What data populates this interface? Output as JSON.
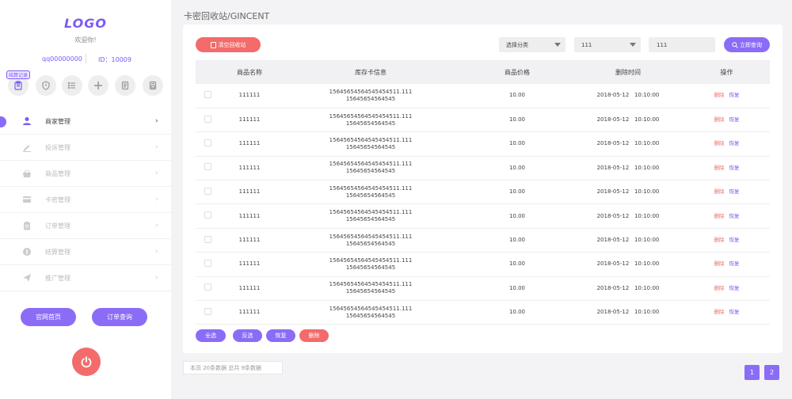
{
  "sidebar": {
    "logo": "LOGO",
    "welcome": "欢迎你!",
    "account": "qq00000000",
    "user_id": "ID：10009",
    "icon_tag": "结算记录",
    "icons": [
      "clipboard-icon",
      "shield-icon",
      "list-icon",
      "plus-icon",
      "document-icon",
      "invoice-icon"
    ],
    "menu": [
      {
        "label": "商家管理",
        "icon": "user-icon",
        "active": true
      },
      {
        "label": "投诉管理",
        "icon": "pencil-icon",
        "active": false
      },
      {
        "label": "商品管理",
        "icon": "basket-icon",
        "active": false
      },
      {
        "label": "卡密管理",
        "icon": "card-icon",
        "active": false
      },
      {
        "label": "订单管理",
        "icon": "clipboard-icon",
        "active": false
      },
      {
        "label": "结算管理",
        "icon": "coin-icon",
        "active": false
      },
      {
        "label": "推广管理",
        "icon": "send-icon",
        "active": false
      }
    ],
    "home_button": "官网首页",
    "order_button": "订单查询"
  },
  "header": {
    "title": "卡密回收站/GINCENT"
  },
  "toolbar": {
    "clear_button": "清空回收站",
    "category_select": "选择分类",
    "second_select": "111",
    "search_value": "111",
    "query_button": "立即查询"
  },
  "table": {
    "columns": [
      "商品名称",
      "库存卡信息",
      "商品价格",
      "删除时间",
      "操作"
    ],
    "rows": [
      {
        "name": "111111",
        "card_line1": "15645654564545454511.111",
        "card_line2": "15645654564545",
        "price": "10.00",
        "time": "2018-05-12   10:10:00"
      },
      {
        "name": "111111",
        "card_line1": "15645654564545454511.111",
        "card_line2": "15645654564545",
        "price": "10.00",
        "time": "2018-05-12   10:10:00"
      },
      {
        "name": "111111",
        "card_line1": "15645654564545454511.111",
        "card_line2": "15645654564545",
        "price": "10.00",
        "time": "2018-05-12   10:10:00"
      },
      {
        "name": "111111",
        "card_line1": "15645654564545454511.111",
        "card_line2": "15645654564545",
        "price": "10.00",
        "time": "2018-05-12   10:10:00"
      },
      {
        "name": "111111",
        "card_line1": "15645654564545454511.111",
        "card_line2": "15645654564545",
        "price": "10.00",
        "time": "2018-05-12   10:10:00"
      },
      {
        "name": "111111",
        "card_line1": "15645654564545454511.111",
        "card_line2": "15645654564545",
        "price": "10.00",
        "time": "2018-05-12   10:10:00"
      },
      {
        "name": "111111",
        "card_line1": "15645654564545454511.111",
        "card_line2": "15645654564545",
        "price": "10.00",
        "time": "2018-05-12   10:10:00"
      },
      {
        "name": "111111",
        "card_line1": "15645654564545454511.111",
        "card_line2": "15645654564545",
        "price": "10.00",
        "time": "2018-05-12   10:10:00"
      },
      {
        "name": "111111",
        "card_line1": "15645654564545454511.111",
        "card_line2": "15645654564545",
        "price": "10.00",
        "time": "2018-05-12   10:10:00"
      },
      {
        "name": "111111",
        "card_line1": "15645654564545454511.111",
        "card_line2": "15645654564545",
        "price": "10.00",
        "time": "2018-05-12   10:10:00"
      }
    ],
    "delete_label": "删除",
    "restore_label": "恢复"
  },
  "footer_buttons": {
    "select_all": "全选",
    "invert": "反选",
    "restore": "恢复",
    "delete": "删除"
  },
  "pagination": {
    "info": "本页 20条数据 总共 9条数据",
    "pages": [
      "1",
      "2"
    ]
  },
  "colors": {
    "accent": "#8b6cf6",
    "danger": "#f36b6b"
  }
}
